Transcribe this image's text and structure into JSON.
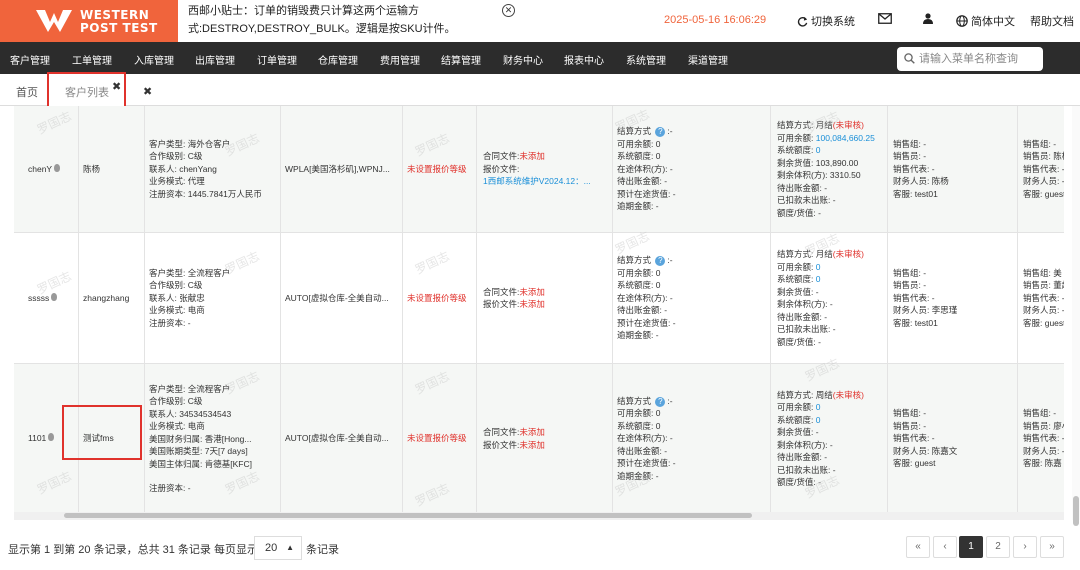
{
  "logo": {
    "line1": "WESTERN",
    "line2": "POST TEST"
  },
  "tip": {
    "text": "西邮小贴士：订单的销毁费只计算这两个运输方式:DESTROY,DESTROY_BULK。逻辑是按SKU计件。"
  },
  "topbar": {
    "datetime": "2025-05-16 16:06:29",
    "switch_system": "切换系统",
    "language": "简体中文",
    "help": "帮助文档"
  },
  "menu": [
    "客户管理",
    "工单管理",
    "入库管理",
    "出库管理",
    "订单管理",
    "仓库管理",
    "费用管理",
    "结算管理",
    "财务中心",
    "报表中心",
    "系统管理",
    "渠道管理"
  ],
  "search": {
    "placeholder": "请输入菜单名称查询"
  },
  "tabs": {
    "home": "首页",
    "customer_list": "客户列表"
  },
  "watermark": "罗国志",
  "rows": [
    {
      "code": "chenY",
      "name": "陈杨",
      "info": [
        "客户类型: 海外仓客户",
        "合作级别: C级",
        "联系人: chenYang",
        "业务模式: 代理",
        "注册资本: 1445.7841万人民币"
      ],
      "channel": "WPLA[美国洛杉矶],WPNJ...",
      "price_level": "未设置报价等级",
      "files": {
        "contract_label": "合同文件:",
        "contract_value": "未添加",
        "quote_label": "报价文件:",
        "quote_value": "1西邮系统维护V2024.12：..."
      },
      "account": [
        "结算方式: -",
        "可用余额: 0",
        "系统额度: 0",
        "在途体积(方): -",
        "待出账金额: -",
        "预计在途货值: -",
        "逾期金额: -"
      ],
      "settle": {
        "method": "结算方式: 月结",
        "review": "(未审核)",
        "avail_label": "可用余额: ",
        "avail_value": "100,084,660.25",
        "credit_label": "系统额度: ",
        "credit_value": "0",
        "rest": [
          "剩余货值: 103,890.00",
          "剩余体积(方): 3310.50",
          "待出账金额: -",
          "已扣款未出账: -",
          "额度/货值: -"
        ]
      },
      "staff": [
        "销售组: -",
        "销售员: -",
        "销售代表: -",
        "财务人员: 陈杨",
        "客服: test01"
      ],
      "staff2": [
        "销售组: -",
        "销售员: 陈杨",
        "销售代表: -",
        "财务人员: -",
        "客服: guest"
      ]
    },
    {
      "code": "sssss",
      "name": "zhangzhang",
      "info": [
        "客户类型: 全流程客户",
        "合作级别: C级",
        "联系人: 张献忠",
        "业务模式: 电商",
        "注册资本: -"
      ],
      "channel": "AUTO[虚拟仓库-全美自动...",
      "price_level": "未设置报价等级",
      "files": {
        "contract_label": "合同文件:",
        "contract_value": "未添加",
        "quote_label": "报价文件:",
        "quote_value": "未添加"
      },
      "account": [
        "结算方式: -",
        "可用余额: 0",
        "系统额度: 0",
        "在途体积(方): -",
        "待出账金额: -",
        "预计在途货值: -",
        "逾期金额: -"
      ],
      "settle": {
        "method": "结算方式: 月结",
        "review": "(未审核)",
        "avail_label": "可用余额: ",
        "avail_value": "0",
        "credit_label": "系统额度: ",
        "credit_value": "0",
        "rest": [
          "剩余货值: -",
          "剩余体积(方): -",
          "待出账金额: -",
          "已扣款未出账: -",
          "额度/货值: -"
        ]
      },
      "staff": [
        "销售组: -",
        "销售员: -",
        "销售代表: -",
        "财务人员: 李思瑾",
        "客服: test01"
      ],
      "staff2": [
        "销售组: 美",
        "销售员: 董超",
        "销售代表: -",
        "财务人员: -",
        "客服: guest"
      ]
    },
    {
      "code": "1101",
      "name": "测试fms",
      "info": [
        "客户类型: 全流程客户",
        "合作级别: C级",
        "联系人: 34534534543",
        "业务模式: 电商",
        "美国财务归属: 香港[Hong...",
        "美国账期类型: 7天[7 days]",
        "美国主体归属: 肯德基[KFC]",
        "",
        "注册资本: -"
      ],
      "channel": "AUTO[虚拟仓库-全美自动...",
      "price_level": "未设置报价等级",
      "files": {
        "contract_label": "合同文件:",
        "contract_value": "未添加",
        "quote_label": "报价文件:",
        "quote_value": "未添加"
      },
      "account": [
        "结算方式: -",
        "可用余额: 0",
        "系统额度: 0",
        "在途体积(方): -",
        "待出账金额: -",
        "预计在途货值: -",
        "逾期金额: -"
      ],
      "settle": {
        "method": "结算方式: 周结",
        "review": "(未审核)",
        "avail_label": "可用余额: ",
        "avail_value": "0",
        "credit_label": "系统额度: ",
        "credit_value": "0",
        "rest": [
          "剩余货值: -",
          "剩余体积(方): -",
          "待出账金额: -",
          "已扣款未出账: -",
          "额度/货值: -"
        ]
      },
      "staff": [
        "销售组: -",
        "销售员: -",
        "销售代表: -",
        "财务人员: 陈嘉文",
        "客服: guest"
      ],
      "staff2": [
        "销售组: -",
        "销售员: 廖小",
        "销售代表: -",
        "财务人员: -",
        "客服: 陈嘉"
      ]
    }
  ],
  "pagination": {
    "info": "显示第 1 到第 20 条记录，总共 31 条记录 每页显示",
    "page_size": "20",
    "records_suffix": "条记录",
    "first": "«",
    "prev": "‹",
    "p1": "1",
    "p2": "2",
    "next": "›",
    "last": "»"
  },
  "colors": {
    "brand": "#f0643c",
    "menubar": "#2c2c2c",
    "alert": "#e0322c",
    "link": "#1a8fd8"
  }
}
